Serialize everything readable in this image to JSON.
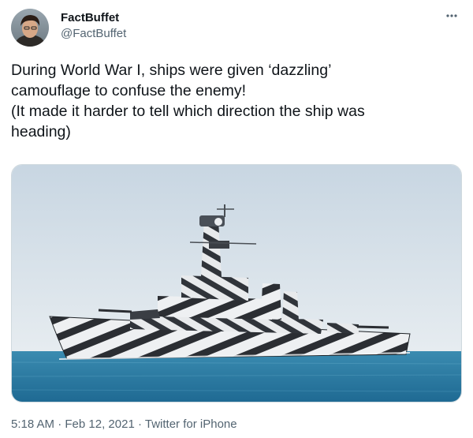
{
  "author": {
    "display_name": "FactBuffet",
    "handle": "@FactBuffet",
    "avatar_icon": "user-avatar"
  },
  "more_icon": "more-horizontal-icon",
  "tweet": {
    "lines": [
      "During World War I, ships were given ‘dazzling’",
      "camouflage to confuse the enemy!",
      "(It made it harder to tell which direction the ship was",
      "heading)"
    ]
  },
  "media": {
    "subject": "dazzle-camouflaged-warship-photo",
    "colors": {
      "sky": "#dde6ee",
      "sea": "#2f7ea6",
      "hull_dark": "#2b2e33",
      "hull_light": "#eef0f2"
    }
  },
  "meta": {
    "time": "5:18 AM",
    "separator": "·",
    "date": "Feb 12, 2021",
    "source": "Twitter for iPhone"
  },
  "colors": {
    "text": "#0f1419",
    "secondary": "#536471",
    "border": "#cfd9de"
  }
}
